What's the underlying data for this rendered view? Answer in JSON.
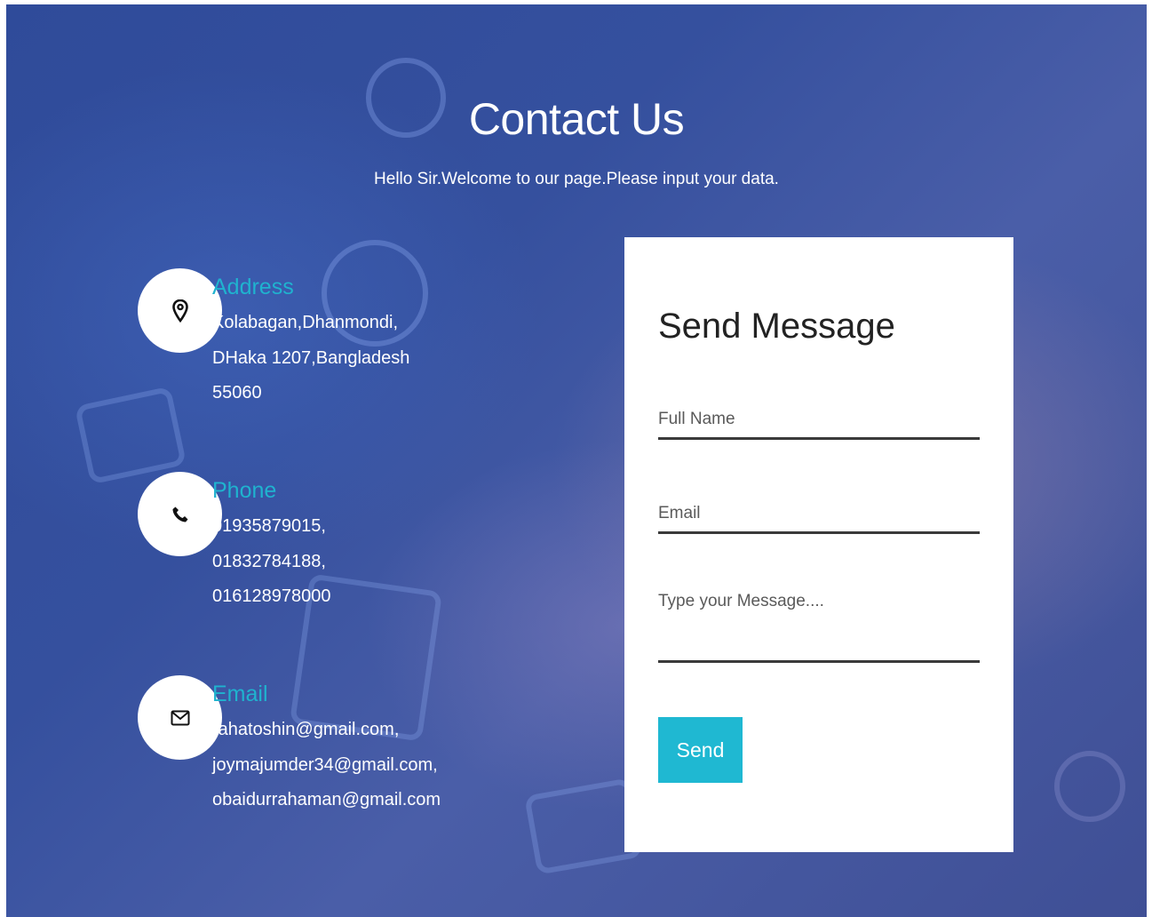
{
  "header": {
    "title": "Contact Us",
    "subtitle": "Hello Sir.Welcome to our page.Please input your data."
  },
  "contact_info": {
    "address": {
      "icon": "map-pin-icon",
      "heading": "Address",
      "lines": [
        "Kolabagan,Dhanmondi,",
        "DHaka 1207,Bangladesh",
        "55060"
      ]
    },
    "phone": {
      "icon": "phone-icon",
      "heading": "Phone",
      "lines": [
        "01935879015,",
        "01832784188,",
        "016128978000"
      ]
    },
    "email": {
      "icon": "envelope-icon",
      "heading": "Email",
      "lines": [
        "rahatoshin@gmail.com,",
        "joymajumder34@gmail.com,",
        "obaidurrahaman@gmail.com"
      ]
    }
  },
  "form": {
    "title": "Send Message",
    "full_name": {
      "placeholder": "Full Name",
      "value": ""
    },
    "email": {
      "placeholder": "Email",
      "value": ""
    },
    "message": {
      "placeholder": "Type your Message....",
      "value": ""
    },
    "send_label": "Send"
  },
  "colors": {
    "accent": "#1fb8d2",
    "heading_accent": "#1fb3cf",
    "background": "#35509e",
    "card": "#ffffff"
  }
}
